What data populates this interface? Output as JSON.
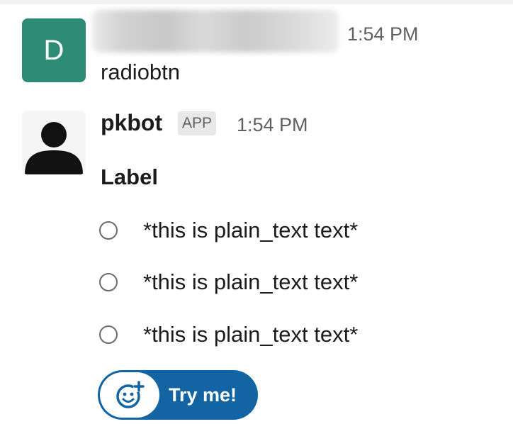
{
  "messages": [
    {
      "avatar_letter": "D",
      "avatar_color": "#2e8b76",
      "sender_name_obscured": true,
      "timestamp": "1:54 PM",
      "text": "radiobtn"
    },
    {
      "avatar_icon": "person-icon",
      "sender": "pkbot",
      "badge": "APP",
      "timestamp": "1:54 PM",
      "block": {
        "label": "Label",
        "radio_options": [
          {
            "text": "*this is plain_text text*",
            "selected": false
          },
          {
            "text": "*this is plain_text text*",
            "selected": false
          },
          {
            "text": "*this is plain_text text*",
            "selected": false
          }
        ],
        "button": {
          "label": "Try me!",
          "icon": "add-emoji-icon",
          "color": "#1264a3"
        }
      }
    }
  ]
}
